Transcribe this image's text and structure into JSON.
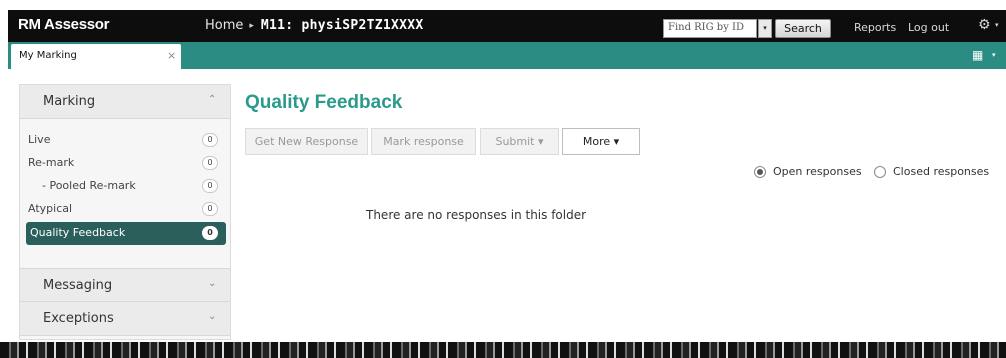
{
  "app": {
    "brand": "RM Assessor"
  },
  "breadcrumb": {
    "home": "Home",
    "separator": "▸",
    "current": "M11: physiSP2TZ1XXXX"
  },
  "search": {
    "placeholder": "Find RIG by ID",
    "button_label": "Search",
    "dropdown_icon": "▾"
  },
  "toplinks": {
    "reports": "Reports",
    "logout": "Log out",
    "settings_icon": "⚙",
    "caret": "▾"
  },
  "tabs": [
    {
      "label": "My Marking",
      "close": "×"
    }
  ],
  "tabbar": {
    "grid_icon": "▦",
    "caret": "▾"
  },
  "sidebar": {
    "marking": {
      "title": "Marking",
      "chevron": "⌃",
      "items": [
        {
          "label": "Live",
          "count": "0"
        },
        {
          "label": "Re-mark",
          "count": "0"
        },
        {
          "label": "- Pooled Re-mark",
          "count": "0"
        },
        {
          "label": "Atypical",
          "count": "0"
        },
        {
          "label": "Quality Feedback",
          "count": "0",
          "active": true
        }
      ]
    },
    "messaging": {
      "title": "Messaging",
      "chevron": "⌄"
    },
    "exceptions": {
      "title": "Exceptions",
      "chevron": "⌄"
    }
  },
  "main": {
    "title": "Quality Feedback",
    "toolbar": {
      "get_new_response": "Get New Response",
      "mark_response": "Mark response",
      "submit": "Submit  ▾",
      "more": "More ▾"
    },
    "filters": {
      "open": "Open responses",
      "closed": "Closed responses",
      "selected": "open"
    },
    "empty_message": "There are no responses in this folder"
  },
  "colors": {
    "accent": "#2b9a8c",
    "tabbar": "#2b8c83",
    "active_item": "#2b5f5c",
    "topbar": "#0d0d0d"
  }
}
